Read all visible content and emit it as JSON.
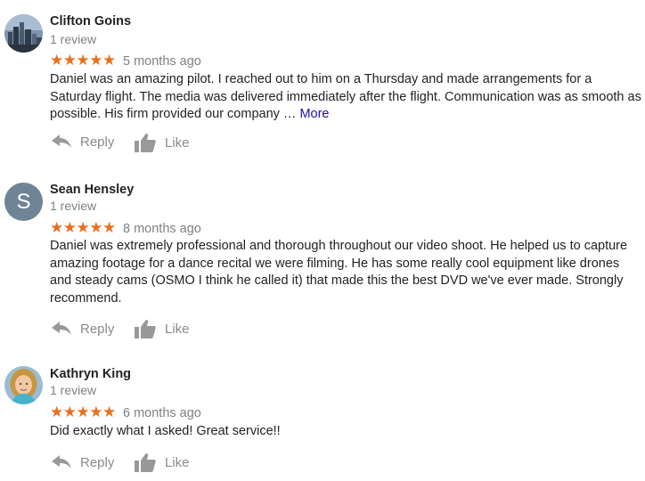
{
  "reviews": [
    {
      "name": "Clifton Goins",
      "count": "1 review",
      "stars": "★★★★★",
      "date": "5 months ago",
      "text": "Daniel was an amazing pilot. I reached out to him on a Thursday and made arrangements for a Saturday flight. The media was delivered immediately after the flight. Communication was as smooth as possible. His firm provided our company … ",
      "more": "More",
      "reply": "Reply",
      "like": "Like"
    },
    {
      "name": "Sean Hensley",
      "initial": "S",
      "count": "1 review",
      "stars": "★★★★★",
      "date": "8 months ago",
      "text": "Daniel was extremely professional and thorough throughout our video shoot. He helped us to capture amazing footage for a dance recital we were filming. He has some really cool equipment like drones and steady cams (OSMO I think he called it) that made this the best DVD we've ever made. Strongly recommend.",
      "reply": "Reply",
      "like": "Like"
    },
    {
      "name": "Kathryn King",
      "count": "1 review",
      "stars": "★★★★★",
      "date": "6 months ago",
      "text": "Did exactly what I asked! Great service!!",
      "reply": "Reply",
      "like": "Like"
    }
  ],
  "colors": {
    "star": "#e7711b",
    "link": "#1a0dab",
    "muted": "#808080",
    "avatar_letter_bg": "#6f8595"
  },
  "icons": {
    "reply": "reply-arrow-icon",
    "like": "thumbs-up-icon"
  }
}
